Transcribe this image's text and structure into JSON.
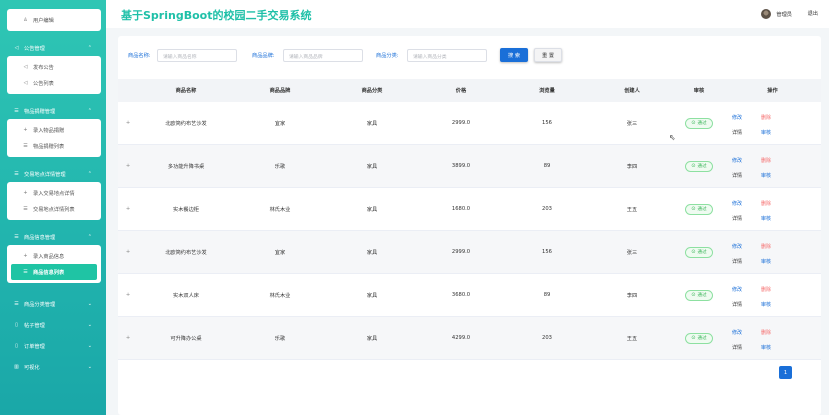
{
  "app": {
    "title": "基于SpringBoot的校园二手交易系统"
  },
  "header": {
    "admin_name": "管理员",
    "logout_label": "退出"
  },
  "sidebar": {
    "top_item": {
      "label": "用户编辑",
      "icon": "user-icon"
    },
    "groups": [
      {
        "label": "公告管理",
        "icon": "megaphone-icon",
        "items": [
          {
            "label": "发布公告",
            "icon": "megaphone-icon"
          },
          {
            "label": "公告列表",
            "icon": "megaphone-icon"
          }
        ]
      },
      {
        "label": "物品捐赠管理",
        "icon": "list-icon",
        "items": [
          {
            "label": "录入物品捐赠",
            "icon": "plus-icon"
          },
          {
            "label": "物品捐赠列表",
            "icon": "list-icon"
          }
        ]
      },
      {
        "label": "交易地点详情管理",
        "icon": "list-icon",
        "items": [
          {
            "label": "录入交易地点详情",
            "icon": "plus-icon"
          },
          {
            "label": "交易地点详情列表",
            "icon": "list-icon"
          }
        ]
      },
      {
        "label": "商品信息管理",
        "icon": "list-icon",
        "items": [
          {
            "label": "录入商品信息",
            "icon": "plus-icon"
          },
          {
            "label": "商品信息列表",
            "icon": "list-icon"
          }
        ]
      }
    ],
    "collapsed": [
      {
        "label": "商品分类管理",
        "icon": "list-icon"
      },
      {
        "label": "帖子管理",
        "icon": "document-icon"
      },
      {
        "label": "订单管理",
        "icon": "document-icon"
      },
      {
        "label": "可视化",
        "icon": "chart-icon"
      }
    ]
  },
  "search": {
    "name_label": "商品名称:",
    "name_placeholder": "请输入商品名称",
    "brand_label": "商品品牌:",
    "brand_placeholder": "请输入商品品牌",
    "category_label": "商品分类:",
    "category_placeholder": "请输入商品分类",
    "search_button": "搜 索",
    "reset_button": "重 置"
  },
  "table": {
    "columns": [
      "商品名称",
      "商品品牌",
      "商品分类",
      "价格",
      "浏览量",
      "创建人",
      "审核",
      "操作"
    ],
    "expand_symbol": "+",
    "rows": [
      {
        "name": "北欧简约布艺沙发",
        "brand": "宜家",
        "category": "家具",
        "price": "2999.0",
        "views": "156",
        "creator": "张三",
        "audit": "通过"
      },
      {
        "name": "多功能升降书桌",
        "brand": "乐歌",
        "category": "家具",
        "price": "3899.0",
        "views": "89",
        "creator": "李四",
        "audit": "通过"
      },
      {
        "name": "实木餐边柜",
        "brand": "林氏木业",
        "category": "家具",
        "price": "1680.0",
        "views": "203",
        "creator": "王五",
        "audit": "通过"
      },
      {
        "name": "北欧简约布艺沙发",
        "brand": "宜家",
        "category": "家具",
        "price": "2999.0",
        "views": "156",
        "creator": "张三",
        "audit": "通过"
      },
      {
        "name": "实木双人床",
        "brand": "林氏木业",
        "category": "家具",
        "price": "3680.0",
        "views": "89",
        "creator": "李四",
        "audit": "通过"
      },
      {
        "name": "可升降办公桌",
        "brand": "乐歌",
        "category": "家具",
        "price": "4299.0",
        "views": "203",
        "creator": "王五",
        "audit": "通过"
      }
    ],
    "ops": {
      "edit": "修改",
      "delete": "删除",
      "detail": "详情",
      "review": "审核"
    }
  },
  "pagination": {
    "current_page": "1"
  },
  "colors": {
    "accent": "#1fc0a8",
    "primary": "#1a6fd8",
    "danger": "#f56c6c",
    "success": "#3bb55a"
  }
}
